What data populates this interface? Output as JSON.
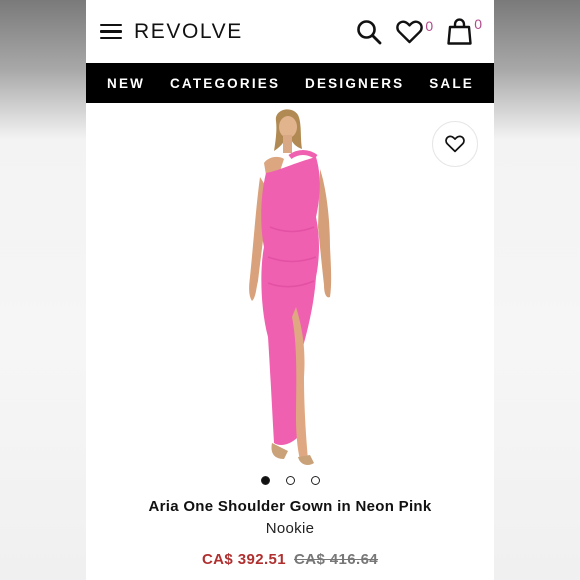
{
  "header": {
    "logo": "REVOLVE",
    "wishlist_count": "0",
    "bag_count": "0"
  },
  "nav": {
    "items": [
      "NEW",
      "CATEGORIES",
      "DESIGNERS",
      "SALE"
    ]
  },
  "gallery": {
    "image_count": 3,
    "active_index": 0
  },
  "product": {
    "title": "Aria One Shoulder Gown in Neon Pink",
    "brand": "Nookie",
    "sale_price": "CA$ 392.51",
    "original_price": "CA$ 416.64"
  },
  "colors": {
    "accent_count": "#b04a8a",
    "sale_price": "#b03030",
    "dress": "#f060b0",
    "nav_bg": "#000000"
  },
  "icons": {
    "menu": "hamburger-icon",
    "search": "search-icon",
    "wishlist": "heart-icon",
    "bag": "shopping-bag-icon",
    "favorite": "heart-outline-icon"
  }
}
